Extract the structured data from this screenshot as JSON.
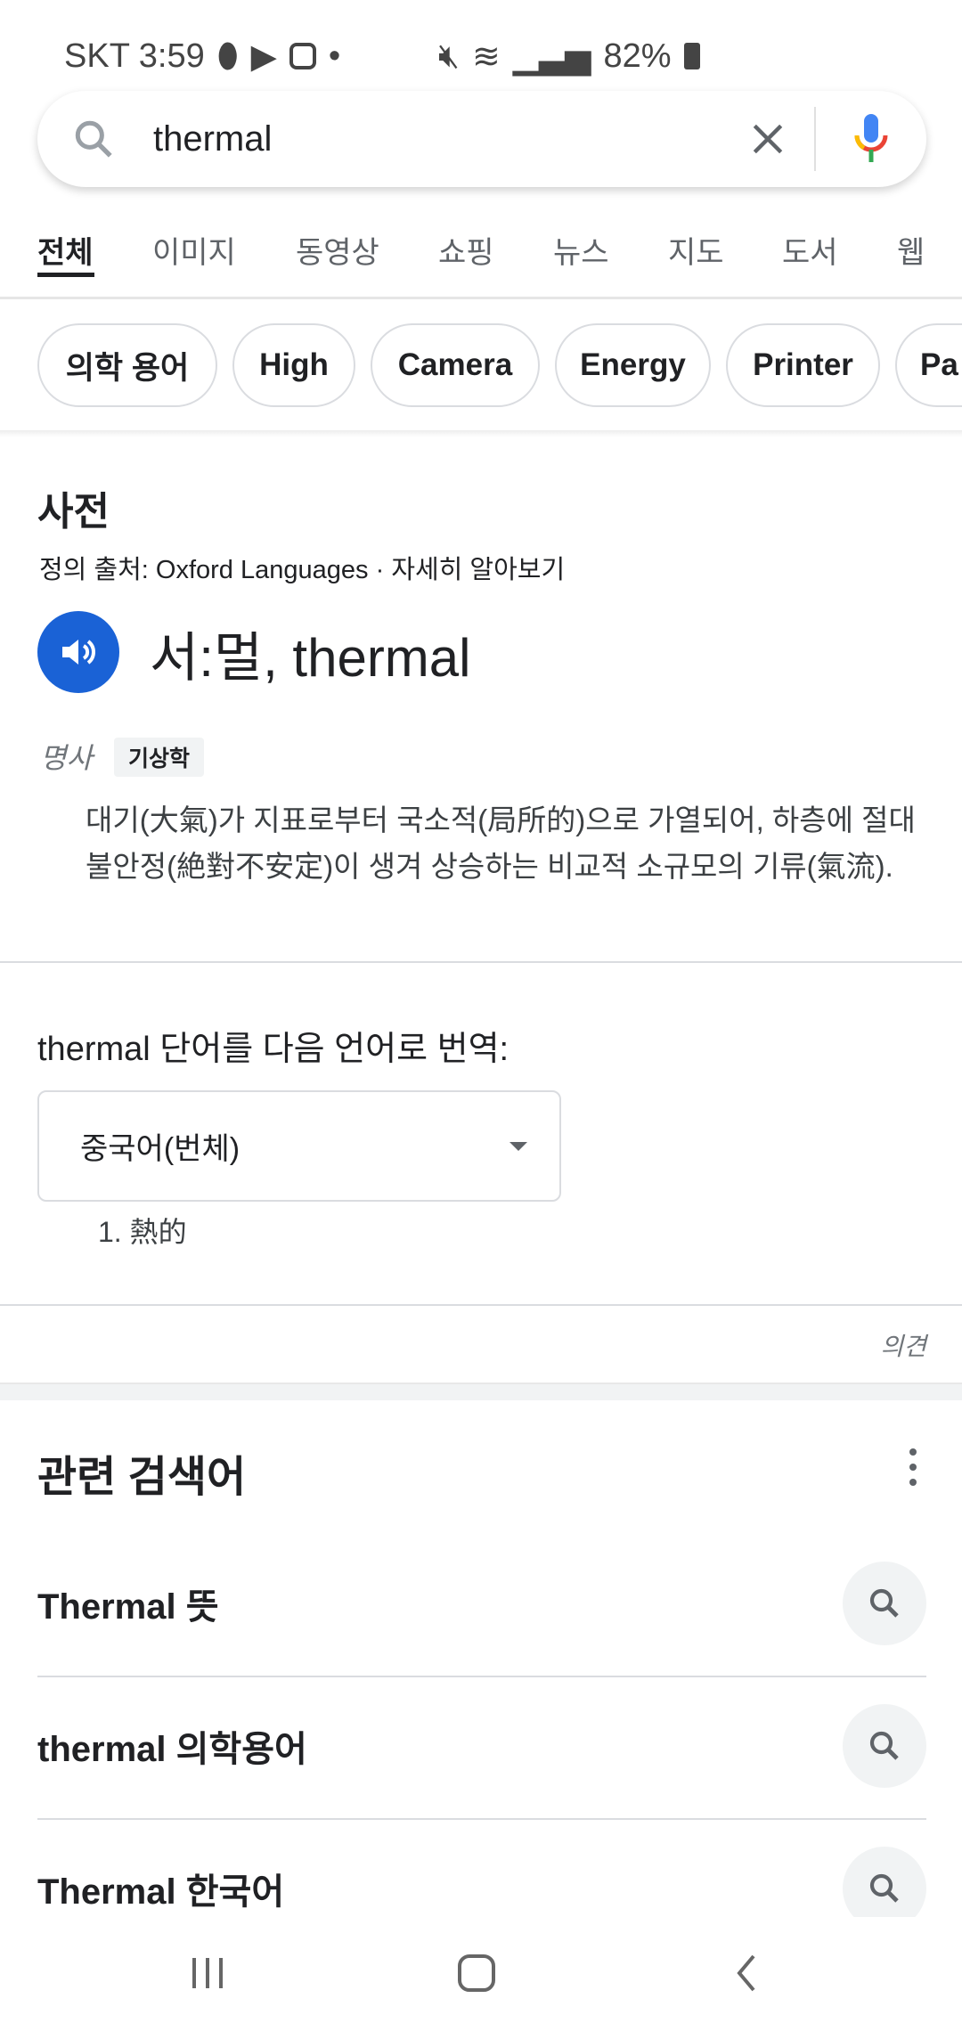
{
  "status_bar": {
    "carrier_time": "SKT 3:59",
    "battery": "82%",
    "icons": [
      "pill-icon",
      "play-icon",
      "instagram-icon",
      "dot-icon",
      "mute-icon",
      "wifi-icon",
      "signal-icon",
      "battery-charging-icon"
    ]
  },
  "search": {
    "query": "thermal",
    "icons": [
      "search-icon",
      "clear-icon",
      "mic-icon"
    ]
  },
  "tabs": [
    {
      "label": "전체",
      "active": true
    },
    {
      "label": "이미지"
    },
    {
      "label": "동영상"
    },
    {
      "label": "쇼핑"
    },
    {
      "label": "뉴스"
    },
    {
      "label": "지도"
    },
    {
      "label": "도서"
    },
    {
      "label": "웹"
    }
  ],
  "chips": [
    "의학 용어",
    "High",
    "Camera",
    "Energy",
    "Printer",
    "Pa"
  ],
  "dictionary": {
    "heading": "사전",
    "source_prefix": "정의 출처:",
    "source": "Oxford Languages",
    "sep": " · ",
    "learn_more": "자세히 알아보기",
    "word": "서:멀, thermal",
    "pos": "명사",
    "tag": "기상학",
    "definition": "대기(大氣)가 지표로부터 국소적(局所的)으로 가열되어, 하층에 절대 불안정(絶對不安定)이 생겨 상승하는 비교적 소규모의 기류(氣流)."
  },
  "translate": {
    "label": "thermal 단어를 다음 언어로 번역:",
    "selected": "중국어(번체)",
    "result": "1. 熱的"
  },
  "feedback": "의견",
  "related": {
    "title": "관련 검색어",
    "items": [
      "Thermal 뜻",
      "thermal 의학용어",
      "Thermal 한국어"
    ]
  },
  "colors": {
    "accent_blue": "#1a62d6"
  }
}
